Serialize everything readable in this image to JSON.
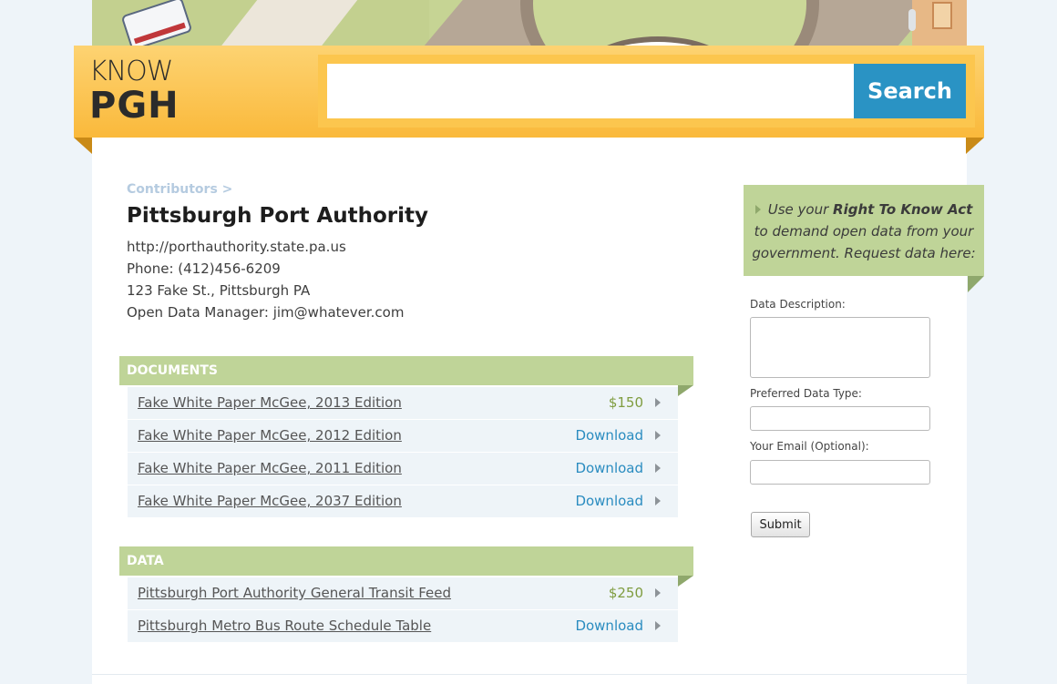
{
  "header": {
    "logo_line1": "KNOW",
    "logo_line2": "PGH",
    "search_placeholder": "",
    "search_button": "Search"
  },
  "contributor": {
    "breadcrumb": "Contributors >",
    "name": "Pittsburgh Port Authority",
    "url": "http://porthauthority.state.pa.us",
    "phone": "Phone: (412)456-6209",
    "address": "123 Fake St., Pittsburgh PA",
    "manager": "Open Data Manager: jim@whatever.com"
  },
  "documents": {
    "heading": "DOCUMENTS",
    "items": [
      {
        "name": "Fake White Paper McGee, 2013 Edition",
        "action": "$150"
      },
      {
        "name": "Fake White Paper McGee, 2012 Edition",
        "action": "Download"
      },
      {
        "name": "Fake White Paper McGee, 2011 Edition",
        "action": "Download"
      },
      {
        "name": "Fake White Paper McGee, 2037 Edition",
        "action": "Download"
      }
    ]
  },
  "data_section": {
    "heading": "DATA",
    "items": [
      {
        "name": "Pittsburgh Port Authority General Transit Feed",
        "action": "$250"
      },
      {
        "name": "Pittsburgh Metro Bus Route Schedule Table",
        "action": "Download"
      }
    ]
  },
  "sidebar": {
    "callout_pre": "Use your ",
    "callout_bold": "Right To Know Act",
    "callout_line2": "to demand open data from your",
    "callout_line3": "government. Request data here:",
    "label_description": "Data Description:",
    "label_type": "Preferred Data Type:",
    "label_email": "Your Email (Optional):",
    "submit_label": "Submit"
  },
  "colors": {
    "header_yellow": "#fab93b",
    "search_blue": "#2a93c4",
    "section_green": "#bfd498",
    "price_green": "#7f9c3f",
    "download_blue": "#2a8cc0"
  }
}
